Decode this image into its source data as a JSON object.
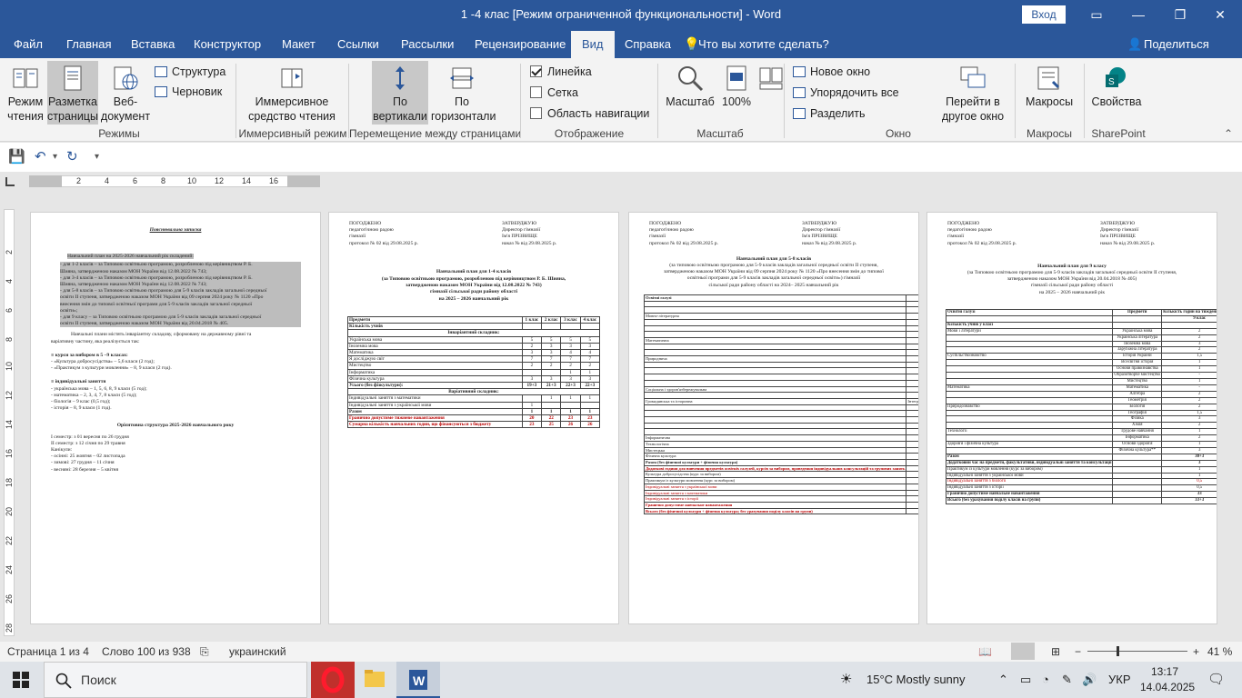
{
  "window": {
    "title": "1 -4 клас [Режим ограниченной функциональности]  -  Word",
    "login": "Вход"
  },
  "tabs": [
    "Файл",
    "Главная",
    "Вставка",
    "Конструктор",
    "Макет",
    "Ссылки",
    "Рассылки",
    "Рецензирование",
    "Вид",
    "Справка"
  ],
  "active_tab": "Вид",
  "tell_me": "Что вы хотите сделать?",
  "share": "Поделиться",
  "ribbon": {
    "read_mode": "Режим чтения",
    "print_layout": "Разметка страницы",
    "web_layout": "Веб-документ",
    "outline": "Структура",
    "draft": "Черновик",
    "group_modes": "Режимы",
    "immersive_reader": "Иммерсивное средство чтения",
    "group_immersive": "Иммерсивный режим",
    "vertical": "По вертикали",
    "side_to_side": "По горизонтали",
    "group_page_movement": "Перемещение между страницами",
    "ruler": "Линейка",
    "gridlines": "Сетка",
    "nav_pane": "Область навигации",
    "group_show": "Отображение",
    "zoom": "Масштаб",
    "zoom100": "100%",
    "group_zoom": "Масштаб",
    "new_window": "Новое окно",
    "arrange_all": "Упорядочить все",
    "split": "Разделить",
    "switch_windows": "Перейти в другое окно",
    "group_window": "Окно",
    "macros": "Макросы",
    "group_macros": "Макросы",
    "properties": "Свойства",
    "group_sharepoint": "SharePoint"
  },
  "ruler_ticks": [
    "2",
    "4",
    "6",
    "8",
    "10",
    "12",
    "14",
    "16"
  ],
  "vruler_ticks": [
    "2",
    "4",
    "6",
    "8",
    "10",
    "12",
    "14",
    "16",
    "18",
    "20",
    "22",
    "24",
    "26",
    "28"
  ],
  "page1": {
    "title": "Пояснювальна записка",
    "intro": "Навчальний план на 2025-2026 навчальний рік складений:",
    "items": [
      "- для 1-2 класів – за Типовою освітньою програмою, розробленою під керівництвом Р. Б.",
      "Шияна, затвердженою наказом МОН України від 12.08.2022 № 743;",
      "- для 3-4 класів – за Типовою освітньою програмою, розробленою під керівництвом Р. Б.",
      "Шияна, затвердженою наказом МОН України від 12.08.2022 № 743;",
      "- для 5-8 класів – за Типовою освітньою програмою для 5-9 класів закладів загальної середньої",
      "освіти II ступеня, затвердженою наказом МОН України від 09 серпня 2024 року № 1120 «Про",
      "внесення змін до типової освітньої програми для 5-9 класів закладів загальної середньої",
      "освіти»;",
      "- для 9 класу – за Типовою освітньою програмою для 5-9 класів закладів загальної середньої",
      "освіти II ступеня, затвердженою наказом МОН України від 20.04.2018 № 405."
    ],
    "para2": "Навчальні плани містять інваріантну складову, сформовану на державному рівні та",
    "para2b": "варіативну частину, яка реалізується так:",
    "courses_h": "≡ курси за вибором в 5 –9 класах:",
    "courses": [
      "- «Культура добросусідства» – 5,6 класи (2 год);",
      "- «Практикум з культури мовлення» – 8, 9 класи (2 год)."
    ],
    "indiv_h": "≡ індивідуальні заняття",
    "indiv": [
      "- українська мова – 1, 5, 6, 8, 9 класи (5 год);",
      "- математика – 2, 3, 4, 7, 8 класи (5 год);",
      "- біологія – 9 клас (0,5 год);",
      "- історія – 8, 9 класи (1 год)."
    ],
    "structure_h": "Орієнтовна структура 2025-2026 навчального року",
    "structure": [
      "I семестр: з 01 вересня по 26 грудня",
      "II семестр: з 12 січня по 29 травня",
      "Канікули:",
      "-    осінні: 25 жовтня – 02 листопада",
      "-    зимові: 27 грудня – 11 січня",
      "-    весняні: 28 березня – 5 квітня"
    ]
  },
  "approval": {
    "left": [
      "ПОГОДЖЕНО",
      "педагогічною      радою",
      "гімназії",
      "протокол № 02 від 29.08.2025 р."
    ],
    "right": [
      "ЗАТВЕРДЖУЮ",
      "Директор          гімназії",
      "Ім'я ПРІЗВИЩЕ",
      "наказ №        від 29.08.2025 р."
    ]
  },
  "page2": {
    "title": "Навчальний план для 1-4 класів",
    "sub": [
      "(за Типовою освітньою програмою, розробленою під керівництвом Р. Б. Шияна,",
      "затвердженою наказом МОН України від 12.08.2022 № 743)",
      "гімназії          сільської ради          району          області",
      "на 2025 – 2026 навчальний рік"
    ],
    "head": [
      "Предмети",
      "1 клас",
      "2 клас",
      "3 клас",
      "4 клас"
    ],
    "head2": "Кількість учнів",
    "inv": "Інваріантний складник:",
    "rows": [
      [
        "Українська мова",
        "5",
        "5",
        "5",
        "5"
      ],
      [
        "Іноземна мова",
        "2",
        "3",
        "3",
        "3"
      ],
      [
        "Математика",
        "3",
        "3",
        "4",
        "4"
      ],
      [
        "Я досліджую світ",
        "7",
        "7",
        "7",
        "7"
      ],
      [
        "Мистецтво",
        "2",
        "2",
        "2",
        "2"
      ],
      [
        "Інформатика",
        "",
        "",
        "1",
        "1"
      ],
      [
        "Фізична культура",
        "3",
        "3",
        "3",
        "3"
      ]
    ],
    "total": [
      "Усього (без фізкультури):",
      "19+3",
      "21+3",
      "22+3",
      "22+3"
    ],
    "var": "Варіативний складник:",
    "vrows": [
      [
        "Індивідуальні заняття з математики",
        "",
        "1",
        "1",
        "1"
      ],
      [
        "Індивідуальні заняття з української мови",
        "1",
        "",
        "",
        ""
      ]
    ],
    "sum": [
      "Разом",
      "1",
      "1",
      "1",
      "1"
    ],
    "limit": [
      "Гранично допустиме тижневе навантаження",
      "20",
      "22",
      "23",
      "23"
    ],
    "funded": [
      "Сумарна кількість навчальних годин, що фінансуються з бюджету",
      "23",
      "25",
      "26",
      "26"
    ]
  },
  "page3": {
    "title": "Навчальний план для 5-8 класів",
    "sub": [
      "(за типовою освітньою програмою для 5-9 класів закладів загальної середньої освіти II ступеня,",
      "затвердженою наказом МОН України від 09 серпня 2024 року № 1120 «Про внесення змін до типової",
      "освітньої програми для 5-9 класів закладів загальної середньої освіти»)          гімназії",
      "сільської ради          району          області на 2024– 2025 навчальний рік"
    ],
    "head": [
      "Освітні галузі",
      "Предмети",
      "Кількість годин"
    ],
    "classes": [
      "Клас",
      "5",
      "6",
      "7",
      "8"
    ],
    "pupils": "Кількість учнів",
    "rows": [
      [
        "Мовно-літературна",
        "Українська мова",
        "4",
        "4",
        "3",
        "3"
      ],
      [
        "",
        "Українська література",
        "2",
        "2",
        "2",
        "2"
      ],
      [
        "",
        "Іноземна мова",
        "3,5",
        "3,5",
        "3,5",
        "3"
      ],
      [
        "",
        "Зарубіжна література",
        "1,5",
        "1,5",
        "1,5",
        "2"
      ],
      [
        "Математична",
        "Математика",
        "5",
        "5",
        "-",
        "-"
      ],
      [
        "",
        "Алгебра",
        "-",
        "-",
        "3",
        "2,5"
      ],
      [
        "",
        "Геометрія",
        "-",
        "-",
        "2",
        "1,5"
      ],
      [
        "Природнича",
        "Інтегрований курс «Пізнаємо природу»",
        "2",
        "2",
        "-",
        "-"
      ],
      [
        "",
        "Біологія",
        "-",
        "-",
        "2,5",
        "2"
      ],
      [
        "",
        "Географія",
        "-",
        "-",
        "2",
        "2"
      ],
      [
        "",
        "Фізика",
        "-",
        "-",
        "2",
        "2"
      ],
      [
        "",
        "Хімія",
        "-",
        "-",
        "1",
        "2"
      ],
      [
        "Соціальна і здоров'язбережувальна",
        "Інтегрований курс «Здоров'я, безпека та добробут»",
        "1",
        "1",
        "1,5",
        "1"
      ],
      [
        "",
        "Етика",
        "0,5",
        "0,5",
        "-",
        "-"
      ],
      [
        "Громадянська та історична",
        "Інтегрований курс «Підприємливість і фінансова грамотність»",
        "-",
        "-",
        "-",
        "0,5"
      ],
      [
        "",
        "Вступ до історії України та громадянської освіти",
        "1",
        "-",
        "-",
        "-"
      ],
      [
        "",
        "Історія України. Всесвітня історія",
        "-",
        "2",
        "-",
        "-"
      ],
      [
        "",
        "Історія України",
        "-",
        "-",
        "1",
        "1,5"
      ],
      [
        "",
        "Всесвітня історія",
        "-",
        "-",
        "1",
        "1"
      ],
      [
        "",
        "Громадянська освіта",
        "-",
        "-",
        "0,5",
        "0,5"
      ],
      [
        "Інформатична",
        "Інформатика",
        "1,5",
        "1,5",
        "2",
        "1,5"
      ],
      [
        "Технологічна",
        "Технології",
        "2",
        "2",
        "1",
        "1"
      ],
      [
        "Мистецька",
        "Інтегрований курс «Мистецтво»",
        "2",
        "2",
        "2",
        "1"
      ],
      [
        "Фізична культура",
        "Фізична культура",
        "3",
        "3",
        "3",
        "3"
      ]
    ],
    "total": [
      "Разом (без фізичної культури + фізична культура)",
      "26 + 3",
      "29 + 3",
      "31,5+3",
      "30+3"
    ],
    "extra": [
      [
        "Додаткові години для вивчення предметів освітніх галузей, курсів за вибором, проведення індивідуальних консультацій та групових занять",
        "2",
        "2",
        "0,5",
        "3"
      ],
      [
        "Культура добросусідства (курс за вибором)",
        "1",
        "1",
        "-",
        "-"
      ],
      [
        "Практикум із культури мовлення (курс за вибором)",
        "-",
        "-",
        "-",
        "1"
      ],
      [
        "Індивідуальні заняття з української мови",
        "1",
        "1",
        "-",
        "1"
      ],
      [
        "Індивідуальні заняття з математики",
        "-",
        "-",
        "0,5",
        "0,5"
      ],
      [
        "Індивідуальні заняття з історії",
        "-",
        "-",
        "-",
        "0,5"
      ],
      [
        "Гранично допустиме навчальне навантаження",
        "28",
        "31",
        "32",
        "33"
      ],
      [
        "Всього (без фізичної культури + фізична культура; без урахування поділу класів на групи)",
        "28 + 3",
        "31 + 3",
        "32 + 3",
        "33+3"
      ]
    ]
  },
  "page4": {
    "title": "Навчальний план  для 9 класу",
    "sub": [
      "(за Типовою освітньою програмою для 5-9 класів закладів загальної середньої освіти II ступеня,",
      "затвердженою наказом МОН України від 20.04.2018 № 405)",
      "гімназії          сільської ради          району          області",
      "на 2025 – 2026  навчальний рік"
    ],
    "head": [
      "Освітні галузі",
      "Предмети",
      "Кількість годин на тиждень у класах"
    ],
    "cls": "9 клас",
    "pupils": "Кількість учнів у класі",
    "rows": [
      [
        "Мови і літератури",
        "Українська мова",
        "2"
      ],
      [
        "",
        "Українська література",
        "2"
      ],
      [
        "",
        "Іноземна мова",
        "3"
      ],
      [
        "",
        "Зарубіжна література",
        "2"
      ],
      [
        "Суспільствознавство",
        "Історія України",
        "1,5"
      ],
      [
        "",
        "Всесвітня історія",
        "1"
      ],
      [
        "",
        "Основи правознавства",
        "1"
      ],
      [
        "",
        "Образотворче мистецтво",
        "-"
      ],
      [
        "",
        "Мистецтво",
        "1"
      ],
      [
        "Математика",
        "Математика",
        "-"
      ],
      [
        "",
        "Алгебра",
        "2"
      ],
      [
        "",
        "Геометрія",
        "2"
      ],
      [
        "Природознавство",
        "Біологія",
        "2"
      ],
      [
        "",
        "Географія",
        "1,5"
      ],
      [
        "",
        "Фізика",
        "3"
      ],
      [
        "",
        "Хімія",
        "2"
      ],
      [
        "Технології",
        "Трудове навчання",
        "1"
      ],
      [
        "",
        "Інформатика",
        "2"
      ],
      [
        "Здоров'я і фізична культура",
        "Основи здоров'я",
        "1"
      ],
      [
        "",
        "Фізична культура**",
        "3"
      ]
    ],
    "sum": [
      "Разом",
      "30+3"
    ],
    "extra_h": [
      "Додатковий час на предмети, факультативи, індивідуальні заняття та консультації",
      "3"
    ],
    "extra": [
      [
        "Практикум із культури мовлення (курс за вибором)",
        "1"
      ],
      [
        "Індивідуальні заняття з української мови",
        "1"
      ],
      [
        "Індивідуальні заняття з біології",
        "0,5"
      ],
      [
        "Індивідуальні заняття з історії",
        "0,5"
      ]
    ],
    "limit": [
      "Гранично допустиме навчальне навантаження",
      "33"
    ],
    "all": [
      "Всього (без урахування поділу класів на групи)",
      "33+3"
    ]
  },
  "status": {
    "page": "Страница 1 из 4",
    "words": "Слово 100 из 938",
    "lang": "украинский",
    "zoom": "41 %"
  },
  "taskbar": {
    "search": "Поиск",
    "weather": "15°C  Mostly sunny",
    "lang": "УКР",
    "time": "13:17",
    "date": "14.04.2025"
  }
}
